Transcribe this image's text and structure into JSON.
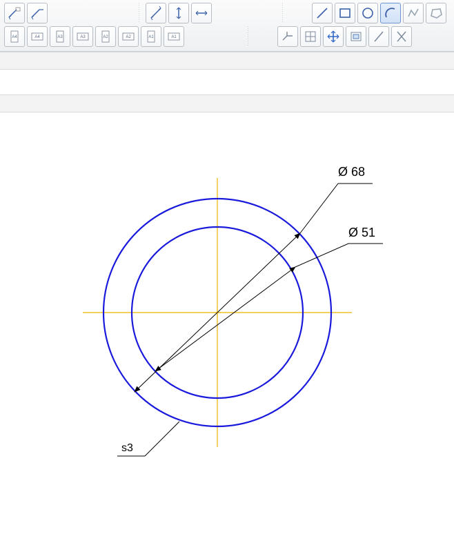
{
  "toolbar": {
    "row1_group1": [
      "annotate-line-1-icon",
      "annotate-line-2-icon"
    ],
    "row1_group2": [
      "dim-diag-icon",
      "dim-vert-icon",
      "dim-horz-icon"
    ],
    "row1_group3": [
      "line-icon",
      "rect-icon",
      "circle-icon",
      "arc-icon",
      "polyline-icon",
      "polygon-icon"
    ],
    "row2_group1_labels": [
      "A4",
      "A4",
      "A3",
      "A3",
      "A2",
      "A2",
      "A1",
      "A1"
    ],
    "row2_group2": [
      "proj-iso-icon",
      "proj-grid-icon",
      "move-icon",
      "view-icon",
      "slash-icon",
      "crossed-icon"
    ]
  },
  "drawing": {
    "dim_outer": "Ø 68",
    "dim_inner": "Ø 51",
    "label_section": "s3"
  },
  "chart_data": {
    "type": "diagram",
    "title": "",
    "shapes": [
      {
        "kind": "circle",
        "diameter": 68,
        "label": "Ø 68"
      },
      {
        "kind": "circle",
        "diameter": 51,
        "label": "Ø 51"
      }
    ],
    "annotations": [
      "s3"
    ]
  }
}
